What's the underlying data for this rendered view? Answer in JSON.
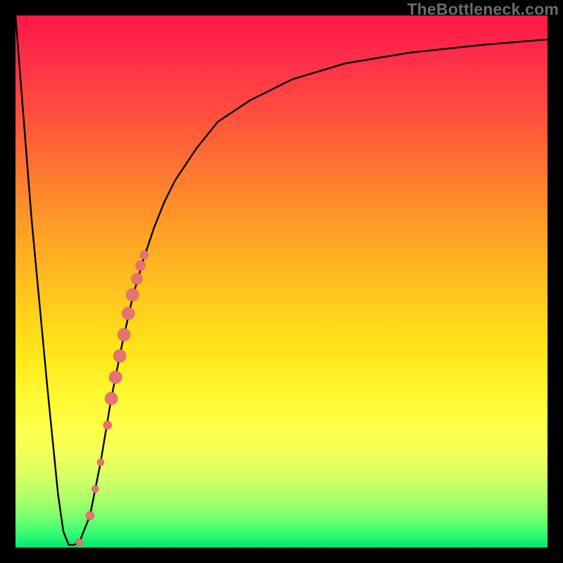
{
  "watermark": "TheBottleneck.com",
  "colors": {
    "background": "#000000",
    "curve": "#000000",
    "marker": "#e57373",
    "marker_stroke": "#d35f5f"
  },
  "chart_data": {
    "type": "line",
    "title": "",
    "xlabel": "",
    "ylabel": "",
    "xlim": [
      0,
      100
    ],
    "ylim": [
      0,
      100
    ],
    "grid": false,
    "legend": false,
    "annotations": [
      {
        "text": "TheBottleneck.com",
        "position": "top-right"
      }
    ],
    "series": [
      {
        "name": "bottleneck-curve",
        "x": [
          0,
          3,
          6,
          8,
          9,
          10,
          11,
          12,
          14,
          16,
          18,
          20,
          22,
          24,
          26,
          28,
          30,
          34,
          38,
          44,
          52,
          62,
          74,
          88,
          100
        ],
        "y": [
          100,
          62,
          30,
          10,
          3,
          0.5,
          0.5,
          1,
          6,
          16,
          28,
          38,
          47,
          54,
          60,
          65,
          69,
          75,
          80,
          84,
          88,
          91,
          93,
          94.5,
          95.5
        ]
      }
    ],
    "markers": [
      {
        "x": 12.0,
        "y": 1.0,
        "r": 5
      },
      {
        "x": 14.0,
        "y": 6.0,
        "r": 6
      },
      {
        "x": 15.0,
        "y": 11.0,
        "r": 5
      },
      {
        "x": 16.0,
        "y": 16.0,
        "r": 5
      },
      {
        "x": 17.3,
        "y": 23.0,
        "r": 6
      },
      {
        "x": 18.0,
        "y": 28.0,
        "r": 9
      },
      {
        "x": 18.8,
        "y": 32.0,
        "r": 9
      },
      {
        "x": 19.6,
        "y": 36.0,
        "r": 9
      },
      {
        "x": 20.4,
        "y": 40.0,
        "r": 9
      },
      {
        "x": 21.2,
        "y": 44.0,
        "r": 9
      },
      {
        "x": 22.0,
        "y": 47.5,
        "r": 9
      },
      {
        "x": 22.8,
        "y": 50.5,
        "r": 8
      },
      {
        "x": 23.5,
        "y": 53.0,
        "r": 7
      },
      {
        "x": 24.2,
        "y": 55.0,
        "r": 6
      }
    ]
  }
}
